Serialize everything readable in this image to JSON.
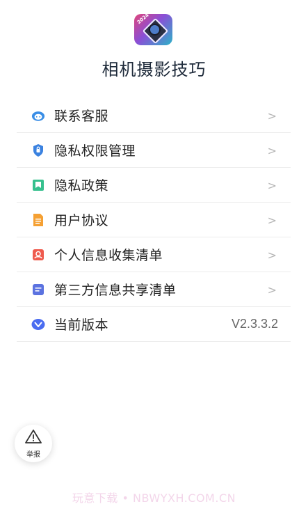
{
  "app": {
    "title": "相机摄影技巧",
    "logo_icon": "camera-lens-icon",
    "logo_tag": "2024"
  },
  "menu": {
    "items": [
      {
        "label": "联系客服",
        "icon": "customer-service-icon",
        "icon_color": "#3a8ee6"
      },
      {
        "label": "隐私权限管理",
        "icon": "shield-icon",
        "icon_color": "#3b82e0"
      },
      {
        "label": "隐私政策",
        "icon": "bookmark-icon",
        "icon_color": "#36c08e"
      },
      {
        "label": "用户协议",
        "icon": "document-icon",
        "icon_color": "#f5a033"
      },
      {
        "label": "个人信息收集清单",
        "icon": "person-card-icon",
        "icon_color": "#ef5a4d"
      },
      {
        "label": "第三方信息共享清单",
        "icon": "list-doc-icon",
        "icon_color": "#5b72e0"
      }
    ],
    "version": {
      "label": "当前版本",
      "value": "V2.3.3.2",
      "icon": "version-icon",
      "icon_color": "#4a6cf0"
    }
  },
  "report": {
    "label": "举报",
    "icon": "warning-icon"
  },
  "watermark": "玩意下载 • NBWYXH.COM.CN"
}
